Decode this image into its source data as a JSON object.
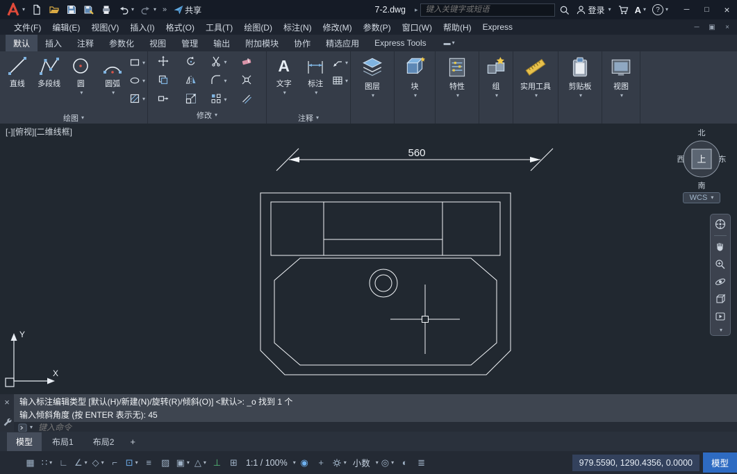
{
  "colors": {
    "brand_red": "#e04a3a",
    "accent_blue": "#7fb3e0",
    "model_badge_blue": "#2e6bc2",
    "canvas_bg": "#212830"
  },
  "icons": {
    "dropdown": "▾",
    "more": "»",
    "flyout": "▸",
    "minimize": "─",
    "maximize": "□",
    "restore": "▣",
    "close": "×",
    "question": "?",
    "a_badge": "A",
    "ribbon_toggle": "▬",
    "add": "+"
  },
  "titlebar": {
    "file_name": "7-2.dwg",
    "share_label": "共享",
    "search_placeholder": "键入关键字或短语",
    "signin_label": "登录"
  },
  "menubar": {
    "items": [
      "文件(F)",
      "编辑(E)",
      "视图(V)",
      "插入(I)",
      "格式(O)",
      "工具(T)",
      "绘图(D)",
      "标注(N)",
      "修改(M)",
      "参数(P)",
      "窗口(W)",
      "帮助(H)",
      "Express"
    ]
  },
  "ribbon": {
    "tabs": [
      {
        "label": "默认"
      },
      {
        "label": "插入"
      },
      {
        "label": "注释"
      },
      {
        "label": "参数化"
      },
      {
        "label": "视图"
      },
      {
        "label": "管理"
      },
      {
        "label": "输出"
      },
      {
        "label": "附加模块"
      },
      {
        "label": "协作"
      },
      {
        "label": "精选应用"
      },
      {
        "label": "Express Tools"
      }
    ],
    "panels": {
      "draw": {
        "title": "绘图",
        "buttons": [
          {
            "label": "直线"
          },
          {
            "label": "多段线"
          },
          {
            "label": "圆"
          },
          {
            "label": "圆弧"
          }
        ]
      },
      "modify": {
        "title": "修改"
      },
      "annotate": {
        "title": "注释",
        "text_glyph": "A",
        "buttons": [
          {
            "label": "文字"
          },
          {
            "label": "标注"
          }
        ]
      },
      "layers": {
        "label": "图层"
      },
      "block": {
        "label": "块"
      },
      "properties": {
        "label": "特性"
      },
      "groups": {
        "label": "组"
      },
      "utilities": {
        "label": "实用工具"
      },
      "clipboard": {
        "label": "剪贴板"
      },
      "view": {
        "label": "视图"
      }
    }
  },
  "viewport": {
    "label": "[-][俯视][二维线框]",
    "dimension_text": "560",
    "viewcube": {
      "north": "北",
      "south": "南",
      "west": "西",
      "east": "东",
      "top": "上",
      "wcs_label": "WCS"
    },
    "ucs": {
      "x_label": "X",
      "y_label": "Y"
    }
  },
  "command": {
    "history": [
      "输入标注编辑类型 [默认(H)/新建(N)/旋转(R)/倾斜(O)] <默认>: _o 找到 1 个",
      "输入倾斜角度 (按 ENTER 表示无): 45"
    ],
    "input_placeholder": "键入命令"
  },
  "layout_tabs": {
    "items": [
      "模型",
      "布局1",
      "布局2"
    ],
    "add_label": "+"
  },
  "statusbar": {
    "icons": [
      {
        "name": "grid-display",
        "glyph": "▦"
      },
      {
        "name": "snap-mode",
        "glyph": "∷"
      },
      {
        "name": "ortho-mode",
        "glyph": "∟"
      },
      {
        "name": "polar-tracking",
        "glyph": "∠"
      },
      {
        "name": "isometric-drafting",
        "glyph": "◇"
      },
      {
        "name": "osnap-tracking",
        "glyph": "⌐"
      },
      {
        "name": "object-snap",
        "glyph": "⊡"
      },
      {
        "name": "lineweight",
        "glyph": "≡"
      },
      {
        "name": "transparency",
        "glyph": "▨"
      },
      {
        "name": "selection-cycling",
        "glyph": "▣"
      },
      {
        "name": "3d-object-snap",
        "glyph": "△"
      },
      {
        "name": "dynamic-ucs",
        "glyph": "⊥"
      },
      {
        "name": "dynamic-input",
        "glyph": "⊞"
      },
      {
        "name": "annotation-visibility",
        "glyph": "◉"
      },
      {
        "name": "annotation-autoscale",
        "glyph": "+"
      },
      {
        "name": "annotation-monitor",
        "glyph": "◎"
      },
      {
        "name": "isolate-objects",
        "glyph": "◐"
      },
      {
        "name": "hardware-acceleration",
        "glyph": "≣"
      }
    ],
    "scale_text": "1:1 / 100%",
    "units_text": "小数",
    "coordinates": "979.5590, 1290.4356, 0.0000",
    "space_label": "模型"
  }
}
